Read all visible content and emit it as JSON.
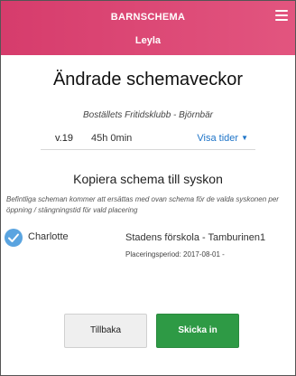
{
  "header": {
    "app_title": "BARNSCHEMA",
    "child_name": "Leyla",
    "menu_icon": "hamburger-menu-icon"
  },
  "main": {
    "title": "Ändrade schemaveckor",
    "unit_name": "Boställets Fritidsklubb - Björnbär",
    "week": {
      "label": "v.19",
      "hours": "45h 0min",
      "show_times_label": "Visa tider",
      "show_times_icon": "caret-down-icon"
    }
  },
  "copy": {
    "title": "Kopiera schema till syskon",
    "info": "Befintliga scheman kommer att ersättas med ovan schema för de valda syskonen per öppning / stängningstid för vald placering",
    "siblings": [
      {
        "name": "Charlotte",
        "checked": true,
        "placement": "Stadens förskola - Tamburinen1",
        "period": "Placeringsperiod: 2017-08-01 -"
      }
    ]
  },
  "buttons": {
    "back_label": "Tillbaka",
    "submit_label": "Skicka in"
  },
  "colors": {
    "header": "#d63c6c",
    "link": "#1e74c8",
    "check": "#5aa4e0",
    "submit": "#2e9a45"
  }
}
